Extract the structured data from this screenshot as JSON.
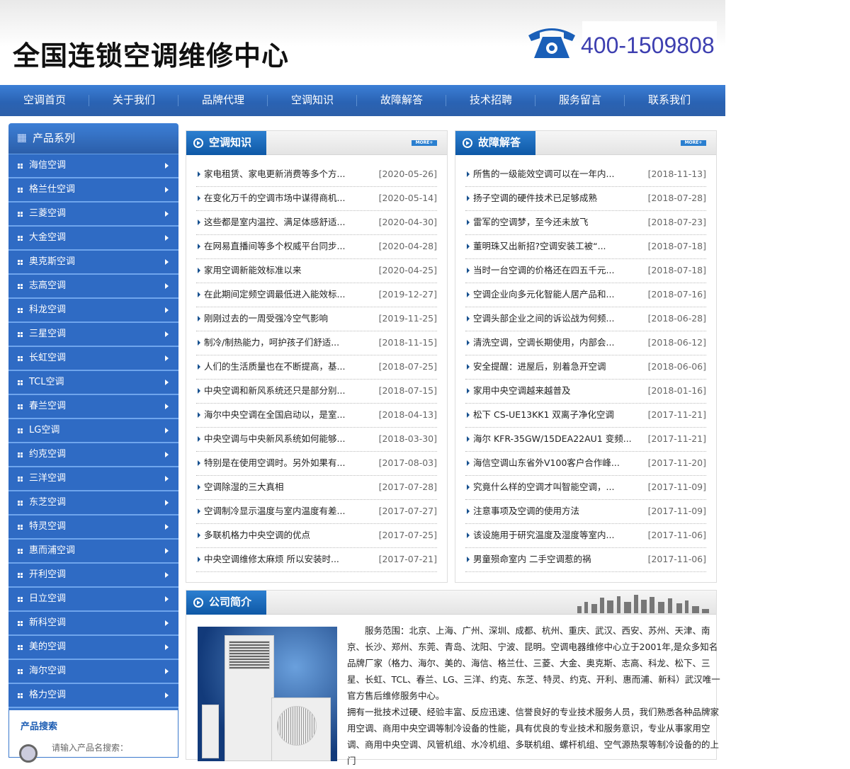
{
  "header": {
    "title": "全国连锁空调维修中心",
    "phone": "400-1509808"
  },
  "nav": [
    "空调首页",
    "关于我们",
    "品牌代理",
    "空调知识",
    "故障解答",
    "技术招聘",
    "服务留言",
    "联系我们"
  ],
  "sidebar": {
    "title": "产品系列",
    "items": [
      "海信空调",
      "格兰仕空调",
      "三菱空调",
      "大金空调",
      "奥克斯空调",
      "志高空调",
      "科龙空调",
      "三星空调",
      "长虹空调",
      "TCL空调",
      "春兰空调",
      "LG空调",
      "约克空调",
      "三洋空调",
      "东芝空调",
      "特灵空调",
      "惠而浦空调",
      "开利空调",
      "日立空调",
      "新科空调",
      "美的空调",
      "海尔空调",
      "格力空调"
    ],
    "search_title": "产品搜索",
    "search_label": "请输入产品名搜索："
  },
  "panels": [
    {
      "title": "空调知识",
      "more": "MORE+",
      "items": [
        [
          "家电租赁、家电更新消费等多个方...",
          "[2020-05-26]"
        ],
        [
          "在变化万千的空调市场中谋得商机...",
          "[2020-05-14]"
        ],
        [
          "这些都是室内温控、满足体感舒适...",
          "[2020-04-30]"
        ],
        [
          "在网易直播间等多个权威平台同步...",
          "[2020-04-28]"
        ],
        [
          "家用空调新能效标准以来",
          "[2020-04-25]"
        ],
        [
          "在此期间定频空调最低进入能效标...",
          "[2019-12-27]"
        ],
        [
          "刚刚过去的一周受强冷空气影响",
          "[2019-11-25]"
        ],
        [
          "制冷/制热能力，呵护孩子们舒适...",
          "[2018-11-15]"
        ],
        [
          "人们的生活质量也在不断提高，基...",
          "[2018-07-25]"
        ],
        [
          "中央空调和新风系统还只是部分别...",
          "[2018-07-15]"
        ],
        [
          "海尔中央空调在全国启动以，是室...",
          "[2018-04-13]"
        ],
        [
          "中央空调与中央新风系统如何能够...",
          "[2018-03-30]"
        ],
        [
          "特别是在使用空调时。另外如果有...",
          "[2017-08-03]"
        ],
        [
          "空调除湿的三大真相",
          "[2017-07-28]"
        ],
        [
          "空调制冷显示温度与室内温度有差...",
          "[2017-07-27]"
        ],
        [
          "多联机格力中央空调的优点",
          "[2017-07-25]"
        ],
        [
          "中央空调维修太麻烦 所以安装时...",
          "[2017-07-21]"
        ]
      ]
    },
    {
      "title": "故障解答",
      "more": "MORE+",
      "items": [
        [
          "所售的一级能效空调可以在一年内...",
          "[2018-11-13]"
        ],
        [
          "扬子空调的硬件技术已足够成熟",
          "[2018-07-28]"
        ],
        [
          "雷军的空调梦，至今还未放飞",
          "[2018-07-23]"
        ],
        [
          "董明珠又出新招?空调安装工被“...",
          "[2018-07-18]"
        ],
        [
          "当时一台空调的价格还在四五千元...",
          "[2018-07-18]"
        ],
        [
          "空调企业向多元化智能人居产品和...",
          "[2018-07-16]"
        ],
        [
          "空调头部企业之间的诉讼战为何频...",
          "[2018-06-28]"
        ],
        [
          "清洗空调，空调长期使用，内部会...",
          "[2018-06-12]"
        ],
        [
          "安全提醒：进屋后，别着急开空调",
          "[2018-06-06]"
        ],
        [
          "家用中央空调越来越普及",
          "[2018-01-16]"
        ],
        [
          "松下 CS-UE13KK1 双离子净化空调",
          "[2017-11-21]"
        ],
        [
          "海尔 KFR-35GW/15DEA22AU1 变频...",
          "[2017-11-21]"
        ],
        [
          "海信空调山东省外V100客户合作峰...",
          "[2017-11-20]"
        ],
        [
          "究竟什么样的空调才叫智能空调，...",
          "[2017-11-09]"
        ],
        [
          "注意事项及空调的使用方法",
          "[2017-11-09]"
        ],
        [
          "该设施用于研究温度及湿度等室内...",
          "[2017-11-06]"
        ],
        [
          "男童殒命室内 二手空调惹的祸",
          "[2017-11-06]"
        ]
      ]
    }
  ],
  "about": {
    "title": "公司简介",
    "p1": "　　服务范围：北京、上海、广州、深圳、成都、杭州、重庆、武汉、西安、苏州、天津、南京、长沙、郑州、东莞、青岛、沈阳、宁波、昆明。空调电器维修中心立于2001年,是众多知名品牌厂家（格力、海尔、美的、海信、格兰仕、三菱、大金、奥克斯、志高、科龙、松下、三星、长虹、TCL、春兰、LG、三洋、约克、东芝、特灵、约克、开利、惠而浦、新科）武汉唯一官方售后维修服务中心。",
    "p2": "拥有一批技术过硬、经验丰富、反应迅速、信誉良好的专业技术服务人员，我们熟悉各种品牌家用空调、商用中央空调等制冷设备的性能，具有优良的专业技术和服务意识，专业从事家用空调、商用中央空调、风管机组、水冷机组、多联机组、螺杆机组、空气源热泵等制冷设备的的上门"
  }
}
